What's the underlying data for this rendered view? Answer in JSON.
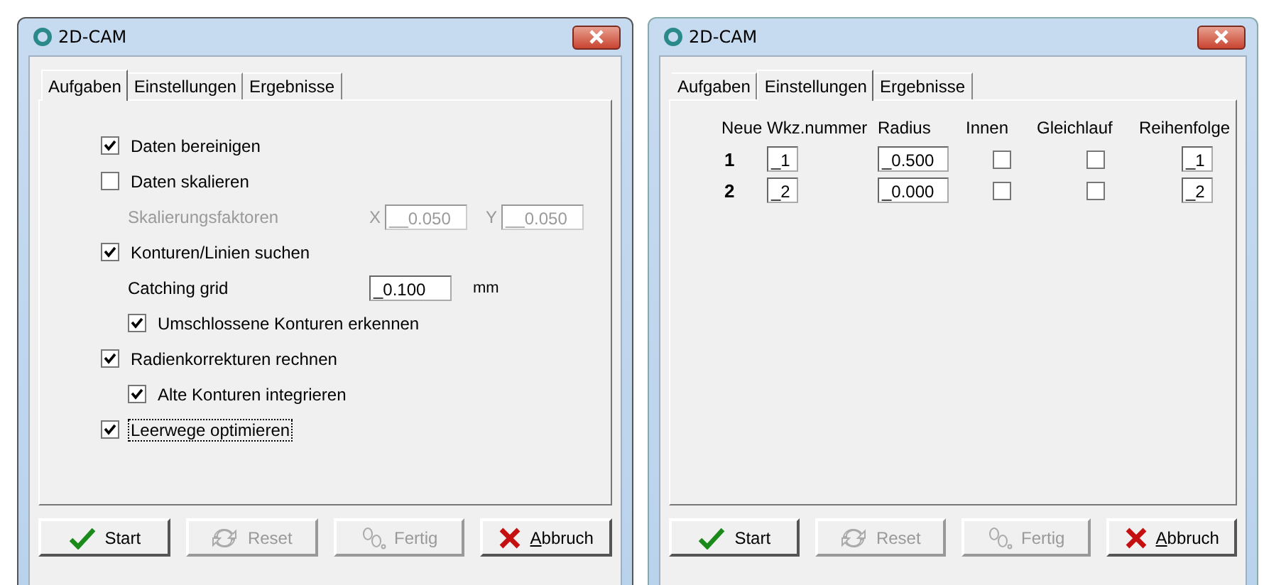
{
  "windows": [
    {
      "title": "2D-CAM",
      "tabs": [
        {
          "label": "Aufgaben",
          "selected": true
        },
        {
          "label": "Einstellungen",
          "selected": false
        },
        {
          "label": "Ergebnisse",
          "selected": false
        }
      ],
      "panel": {
        "kind": "options",
        "options": [
          {
            "kind": "checkbox",
            "label": "Daten bereinigen",
            "checked": true
          },
          {
            "kind": "checkbox",
            "label": "Daten skalieren",
            "checked": false,
            "children": [
              {
                "kind": "scale",
                "label": "Skalierungsfaktoren",
                "disabled": true,
                "x_label": "X",
                "x_value": "__0.050",
                "y_label": "Y",
                "y_value": "__0.050"
              }
            ]
          },
          {
            "kind": "checkbox",
            "label": "Konturen/Linien suchen",
            "checked": true,
            "children": [
              {
                "kind": "field",
                "label": "Catching grid",
                "value": "_0.100",
                "unit": "mm"
              },
              {
                "kind": "checkbox",
                "label": "Umschlossene Konturen erkennen",
                "checked": true
              }
            ]
          },
          {
            "kind": "checkbox",
            "label": "Radienkorrekturen rechnen",
            "checked": true,
            "children": [
              {
                "kind": "checkbox",
                "label": "Alte Konturen integrieren",
                "checked": true
              }
            ]
          },
          {
            "kind": "checkbox",
            "label": "Leerwege optimieren",
            "checked": true,
            "focused": true
          }
        ]
      },
      "buttons": [
        {
          "label": "Start",
          "kind": "check",
          "disabled": false
        },
        {
          "label": "Reset",
          "kind": "refresh",
          "disabled": true
        },
        {
          "label": "Fertig",
          "kind": "footprints",
          "disabled": true
        },
        {
          "label": "Abbruch",
          "kind": "cross",
          "disabled": false
        }
      ]
    },
    {
      "title": "2D-CAM",
      "tabs": [
        {
          "label": "Aufgaben",
          "selected": false
        },
        {
          "label": "Einstellungen",
          "selected": true
        },
        {
          "label": "Ergebnisse",
          "selected": false
        }
      ],
      "panel": {
        "kind": "table",
        "columns": [
          "Neue",
          "Wkz.nummer",
          "Radius",
          "Innen",
          "Gleichlauf",
          "Reihenfolge"
        ],
        "rows": [
          {
            "number": "1",
            "tool": "_1",
            "radius": "_0.500",
            "innen": false,
            "gleichlauf": false,
            "order": "_1"
          },
          {
            "number": "2",
            "tool": "_2",
            "radius": "_0.000",
            "innen": false,
            "gleichlauf": false,
            "order": "_2"
          }
        ]
      },
      "buttons": [
        {
          "label": "Start",
          "kind": "check",
          "disabled": false
        },
        {
          "label": "Reset",
          "kind": "refresh",
          "disabled": true
        },
        {
          "label": "Fertig",
          "kind": "footprints",
          "disabled": true
        },
        {
          "label": "Abbruch",
          "kind": "cross",
          "disabled": false
        }
      ]
    }
  ]
}
